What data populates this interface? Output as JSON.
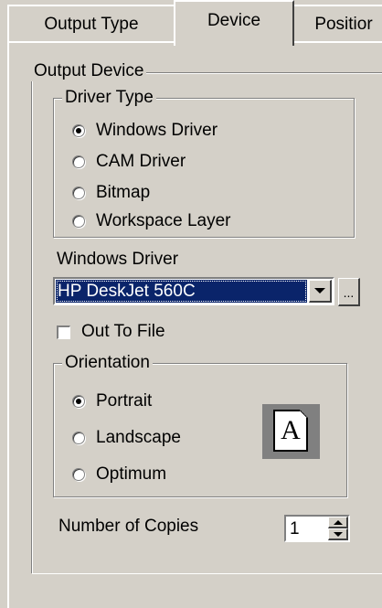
{
  "tabs": [
    {
      "label": "Output Type",
      "active": false
    },
    {
      "label": "Device",
      "active": true
    },
    {
      "label": "Positior",
      "active": false
    }
  ],
  "output_device": {
    "label": "Output Device",
    "driver_type": {
      "label": "Driver Type",
      "options": [
        {
          "label": "Windows Driver",
          "checked": true
        },
        {
          "label": "CAM Driver",
          "checked": false
        },
        {
          "label": "Bitmap",
          "checked": false
        },
        {
          "label": "Workspace Layer",
          "checked": false
        }
      ]
    },
    "windows_driver": {
      "label": "Windows Driver",
      "value": "HP DeskJet 560C",
      "browse_label": "..."
    },
    "out_to_file": {
      "label": "Out To File",
      "checked": false
    },
    "orientation": {
      "label": "Orientation",
      "options": [
        {
          "label": "Portrait",
          "checked": true
        },
        {
          "label": "Landscape",
          "checked": false
        },
        {
          "label": "Optimum",
          "checked": false
        }
      ],
      "preview_letter": "A"
    },
    "copies": {
      "label": "Number of Copies",
      "value": "1"
    }
  }
}
